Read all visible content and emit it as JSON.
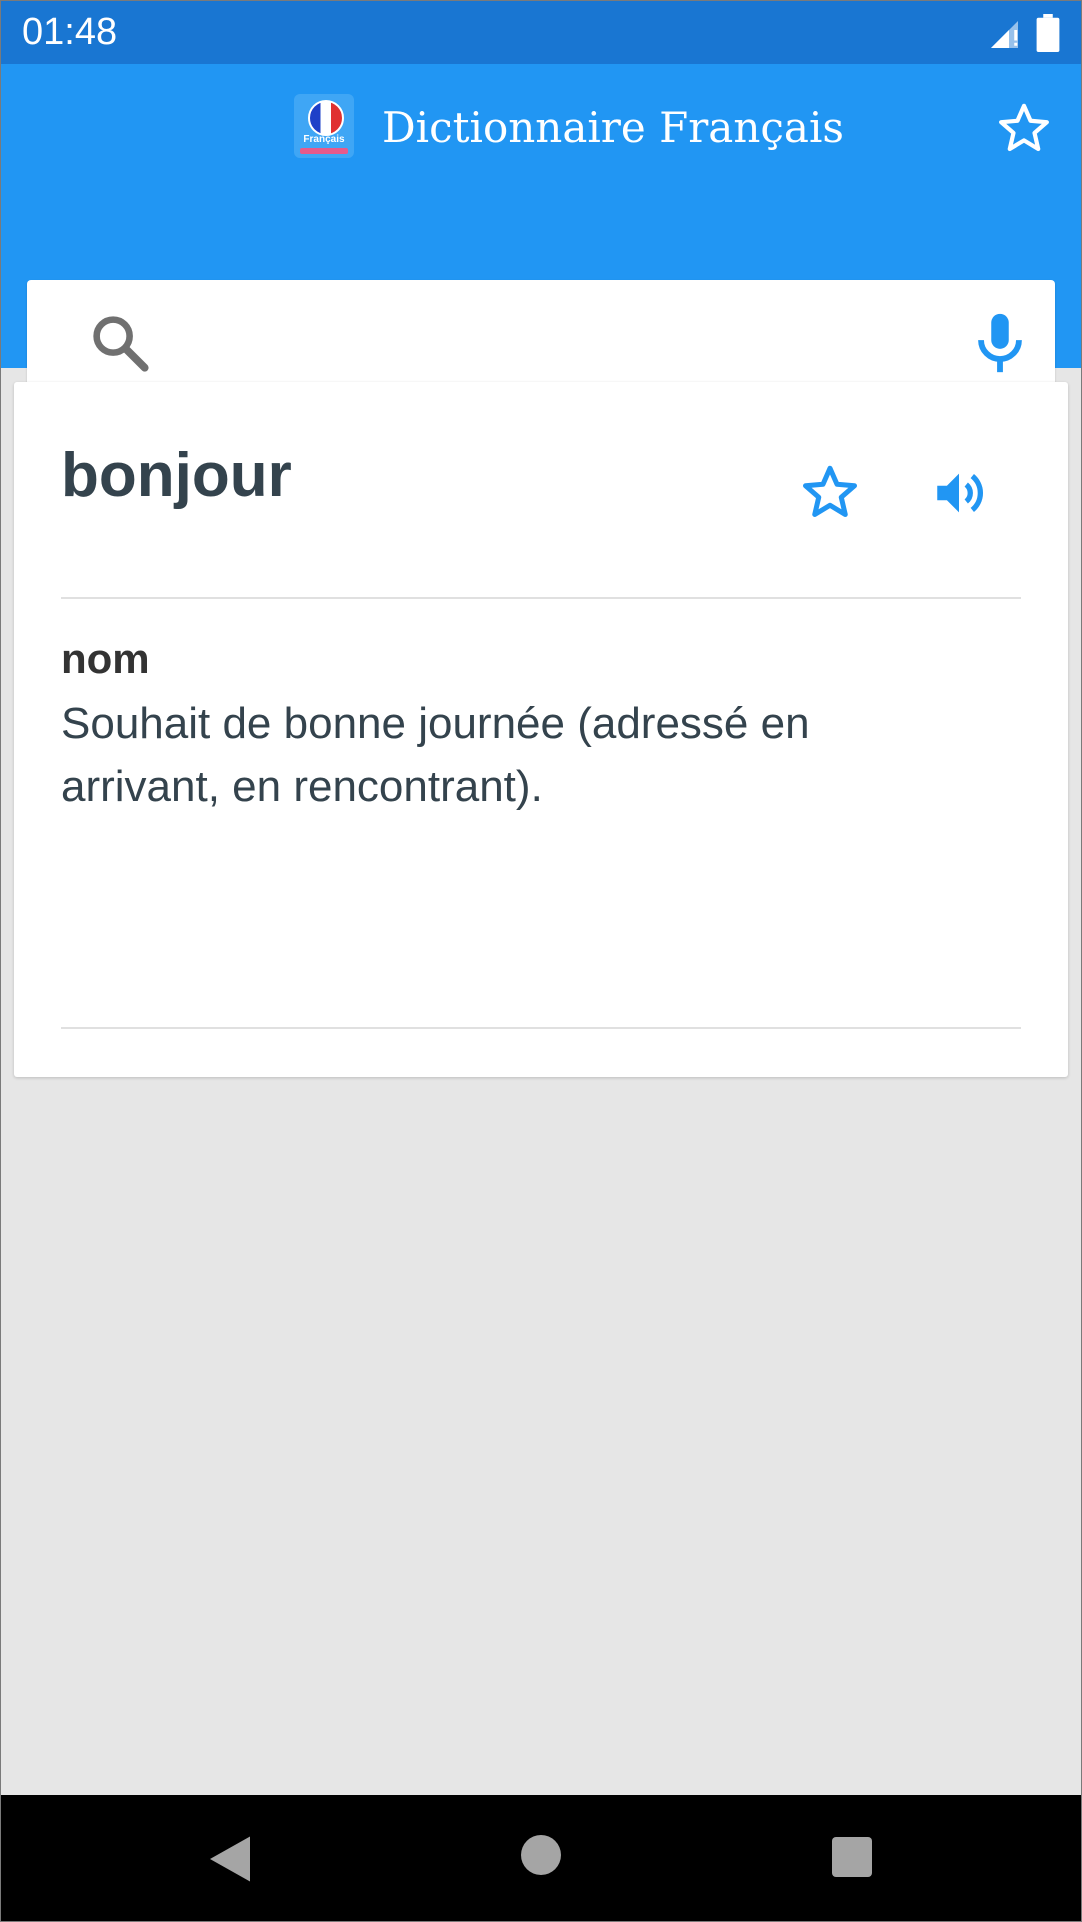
{
  "status_bar": {
    "time": "01:48"
  },
  "app_bar": {
    "title": "Dictionnaire Français",
    "logo_label": "Français"
  },
  "search": {
    "value": "",
    "placeholder": ""
  },
  "entry": {
    "word": "bonjour",
    "part_of_speech": "nom",
    "definition": "Souhait de bonne journée (adressé en arrivant, en rencontrant)."
  },
  "colors": {
    "status_bar": "#1976d2",
    "app_bar": "#2196f3",
    "accent": "#2196f3",
    "word_text": "#34434d",
    "background": "#e6e6e6"
  },
  "icons": [
    "signal-icon",
    "battery-icon",
    "app-logo",
    "favorites-star-icon",
    "search-icon",
    "microphone-icon",
    "bookmark-star-icon",
    "speaker-icon",
    "back-icon",
    "home-icon",
    "recents-icon"
  ]
}
